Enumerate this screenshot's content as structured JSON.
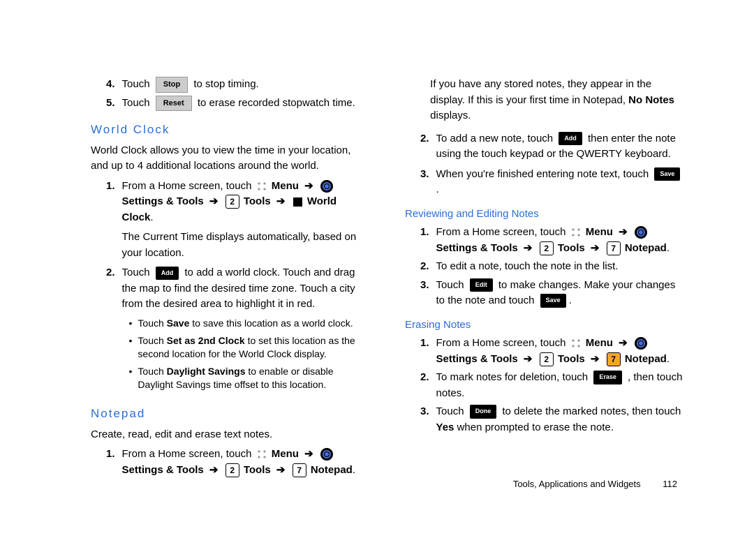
{
  "labels": {
    "stop": "Stop",
    "reset": "Reset",
    "add": "Add",
    "save": "Save",
    "edit": "Edit",
    "erase": "Erase",
    "done": "Done",
    "menu": "Menu",
    "settings_tools": "Settings & Tools",
    "tools": "Tools",
    "world_clock": "World Clock",
    "notepad": "Notepad",
    "yes": "Yes",
    "no_notes": "No Notes",
    "save_bold": "Save",
    "set2nd": "Set as 2nd Clock",
    "dls": "Daylight Savings"
  },
  "keys": {
    "k2": "2",
    "k7": "7"
  },
  "arrow": "➔",
  "nums": {
    "n1": "1.",
    "n2": "2.",
    "n3": "3.",
    "n4": "4.",
    "n5": "5."
  },
  "heads": {
    "world_clock": "World Clock",
    "notepad": "Notepad",
    "reviewing": "Reviewing and Editing Notes",
    "erasing": "Erasing Notes"
  },
  "txt": {
    "touch": "Touch",
    "stop_tail": "to stop timing.",
    "reset_tail": "to erase recorded stopwatch time.",
    "wc_intro": "World Clock allows you to view the time in your location, and up to 4 additional locations around the world.",
    "from_home": "From a Home screen, touch",
    "wc_after": "The Current Time displays automatically, based on your location.",
    "wc_add_tail": "to add a world clock.  Touch and drag the map to find the desired time zone. Touch a city from the desired area to highlight it in red.",
    "bul_save_pre": "Touch ",
    "bul_save_post": " to save this location as a world clock.",
    "bul_2nd_pre": "Touch ",
    "bul_2nd_post": " to set this location as the second location for the World Clock display.",
    "bul_dls_pre": "Touch ",
    "bul_dls_post": " to enable or disable Daylight Savings time offset to this location.",
    "np_intro": "Create, read, edit and erase text notes.",
    "np_stored": "If you have any stored notes, they appear in the display. If this is your first time in Notepad, ",
    "np_stored_post": " displays.",
    "np_add_pre": "To add a new note, touch",
    "np_add_post": "then enter the note using the touch keypad or the QWERTY keyboard.",
    "np_finish_pre": "When you're finished entering note text, touch",
    "np_finish_post": ".",
    "rev_edit": "To edit a note, touch the note in the list.",
    "rev_touch_edit_post": "to make changes. Make your changes to the note and touch",
    "er_mark_pre": "To mark notes for deletion, touch",
    "er_mark_post": ", then touch notes.",
    "er_done_post": "to delete the marked notes, then touch ",
    "er_done_post2": " when prompted to erase the note."
  },
  "footer": {
    "section": "Tools, Applications and Widgets",
    "page": "112"
  }
}
